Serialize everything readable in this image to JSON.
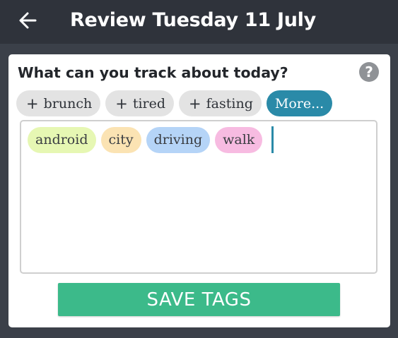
{
  "appbar": {
    "back_icon": "arrow-left-icon",
    "title": "Review Tuesday 11 July"
  },
  "card": {
    "question": "What can you track about today?",
    "help_icon": "help-icon",
    "help_label": "?"
  },
  "suggestions": [
    {
      "prefix": "+",
      "label": "brunch"
    },
    {
      "prefix": "+",
      "label": "tired"
    },
    {
      "prefix": "+",
      "label": "fasting"
    }
  ],
  "more_label": "More...",
  "tags": [
    {
      "label": "android",
      "color": "#e6f7b3"
    },
    {
      "label": "city",
      "color": "#fbe3b3"
    },
    {
      "label": "driving",
      "color": "#b5d4f7"
    },
    {
      "label": "walk",
      "color": "#f7bbe1"
    }
  ],
  "save_label": "SAVE TAGS",
  "colors": {
    "appbar": "#2f333b",
    "accent": "#2a8aa8",
    "save": "#3cba8a"
  }
}
